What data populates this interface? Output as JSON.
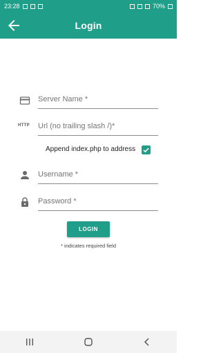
{
  "statusbar": {
    "time": "23:28",
    "battery": "70%"
  },
  "appbar": {
    "title": "Login"
  },
  "form": {
    "server_name": {
      "placeholder": "Server Name *"
    },
    "url": {
      "icon_text": "HTTP",
      "placeholder": "Url (no trailing slash /)*"
    },
    "append_index": {
      "label": "Append index.php to address",
      "checked": true
    },
    "username": {
      "placeholder": "Username *"
    },
    "password": {
      "placeholder": "Password *"
    },
    "login_label": "LOGIN",
    "required_note": "* indicates required field"
  },
  "colors": {
    "primary": "#1f9e89",
    "navbar": "#f3f3f3"
  },
  "icons": [
    "back-arrow-icon",
    "server-card-icon",
    "person-icon",
    "lock-icon",
    "check-icon",
    "recents-icon",
    "home-icon",
    "back-icon"
  ]
}
